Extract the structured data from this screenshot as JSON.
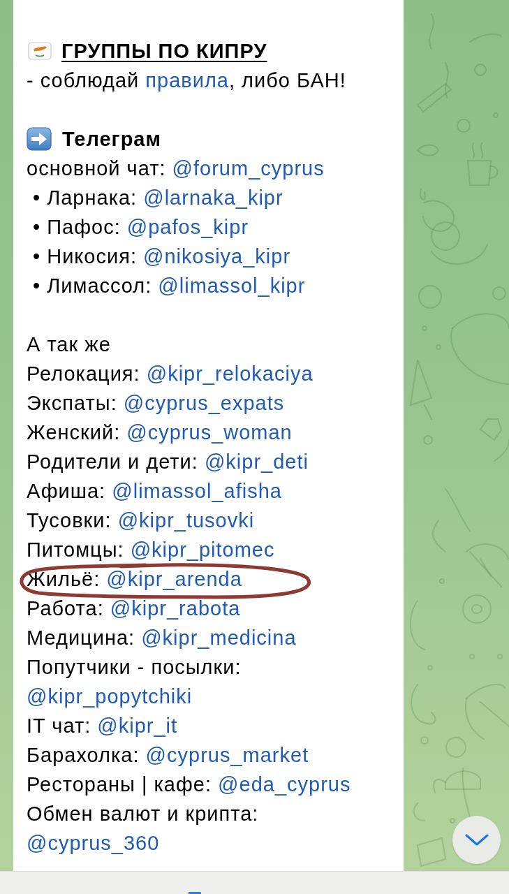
{
  "message": {
    "paragraphs": [
      {
        "lines": [
          {
            "kind": "title",
            "circled": false,
            "parts": [
              {
                "kind": "text",
                "text": "ГРУППЫ ПО КИПРУ"
              }
            ]
          },
          {
            "kind": "plain",
            "circled": false,
            "parts": [
              {
                "kind": "text",
                "text": "- соблюдай "
              },
              {
                "kind": "link",
                "text": "правила"
              },
              {
                "kind": "text",
                "text": ", либо БАН!"
              }
            ]
          }
        ]
      },
      {
        "lines": [
          {
            "kind": "heading",
            "circled": false,
            "parts": [
              {
                "kind": "text",
                "text": "Телеграм"
              }
            ]
          },
          {
            "kind": "plain",
            "circled": false,
            "parts": [
              {
                "kind": "text",
                "text": "основной чат: "
              },
              {
                "kind": "link",
                "text": "@forum_cyprus"
              }
            ]
          },
          {
            "kind": "bullet",
            "circled": false,
            "parts": [
              {
                "kind": "text",
                "text": "• Ларнака: "
              },
              {
                "kind": "link",
                "text": "@larnaka_kipr"
              }
            ]
          },
          {
            "kind": "bullet",
            "circled": false,
            "parts": [
              {
                "kind": "text",
                "text": "• Пафос: "
              },
              {
                "kind": "link",
                "text": "@pafos_kipr"
              }
            ]
          },
          {
            "kind": "bullet",
            "circled": false,
            "parts": [
              {
                "kind": "text",
                "text": "• Никосия: "
              },
              {
                "kind": "link",
                "text": "@nikosiya_kipr"
              }
            ]
          },
          {
            "kind": "bullet",
            "circled": false,
            "parts": [
              {
                "kind": "text",
                "text": "• Лимассол: "
              },
              {
                "kind": "link",
                "text": "@limassol_kipr"
              }
            ]
          }
        ]
      },
      {
        "lines": [
          {
            "kind": "plain",
            "circled": false,
            "parts": [
              {
                "kind": "text",
                "text": "А так же"
              }
            ]
          },
          {
            "kind": "plain",
            "circled": false,
            "parts": [
              {
                "kind": "text",
                "text": "Релокация: "
              },
              {
                "kind": "link",
                "text": "@kipr_relokaciya"
              }
            ]
          },
          {
            "kind": "plain",
            "circled": false,
            "parts": [
              {
                "kind": "text",
                "text": "Экспаты: "
              },
              {
                "kind": "link",
                "text": "@cyprus_expats"
              }
            ]
          },
          {
            "kind": "plain",
            "circled": false,
            "parts": [
              {
                "kind": "text",
                "text": "Женский: "
              },
              {
                "kind": "link",
                "text": "@cyprus_woman"
              }
            ]
          },
          {
            "kind": "plain",
            "circled": false,
            "parts": [
              {
                "kind": "text",
                "text": "Родители и дети: "
              },
              {
                "kind": "link",
                "text": "@kipr_deti"
              }
            ]
          },
          {
            "kind": "plain",
            "circled": false,
            "parts": [
              {
                "kind": "text",
                "text": "Афиша: "
              },
              {
                "kind": "link",
                "text": "@limassol_afisha"
              }
            ]
          },
          {
            "kind": "plain",
            "circled": false,
            "parts": [
              {
                "kind": "text",
                "text": "Тусовки: "
              },
              {
                "kind": "link",
                "text": "@kipr_tusovki"
              }
            ]
          },
          {
            "kind": "plain",
            "circled": false,
            "parts": [
              {
                "kind": "text",
                "text": "Питомцы: "
              },
              {
                "kind": "link",
                "text": "@kipr_pitomec"
              }
            ]
          },
          {
            "kind": "plain",
            "circled": true,
            "parts": [
              {
                "kind": "text",
                "text": "Жильё: "
              },
              {
                "kind": "link",
                "text": "@kipr_arenda"
              }
            ]
          },
          {
            "kind": "plain",
            "circled": false,
            "parts": [
              {
                "kind": "text",
                "text": "Работа: "
              },
              {
                "kind": "link",
                "text": "@kipr_rabota"
              }
            ]
          },
          {
            "kind": "plain",
            "circled": false,
            "parts": [
              {
                "kind": "text",
                "text": "Медицина: "
              },
              {
                "kind": "link",
                "text": "@kipr_medicina"
              }
            ]
          },
          {
            "kind": "plain",
            "circled": false,
            "parts": [
              {
                "kind": "text",
                "text": "Попутчики - посылки: "
              },
              {
                "kind": "link",
                "text": "@kipr_popytchiki"
              }
            ]
          },
          {
            "kind": "plain",
            "circled": false,
            "parts": [
              {
                "kind": "text",
                "text": "IT чат: "
              },
              {
                "kind": "link",
                "text": "@kipr_it"
              }
            ]
          },
          {
            "kind": "plain",
            "circled": false,
            "parts": [
              {
                "kind": "text",
                "text": "Барахолка: "
              },
              {
                "kind": "link",
                "text": "@cyprus_market"
              }
            ]
          },
          {
            "kind": "plain",
            "circled": false,
            "parts": [
              {
                "kind": "text",
                "text": "Рестораны | кафе: "
              },
              {
                "kind": "link",
                "text": "@eda_cyprus"
              }
            ]
          },
          {
            "kind": "plain",
            "circled": false,
            "parts": [
              {
                "kind": "text",
                "text": "Обмен валют и крипта: "
              },
              {
                "kind": "link",
                "text": "@cyprus_360"
              }
            ]
          }
        ]
      }
    ]
  }
}
